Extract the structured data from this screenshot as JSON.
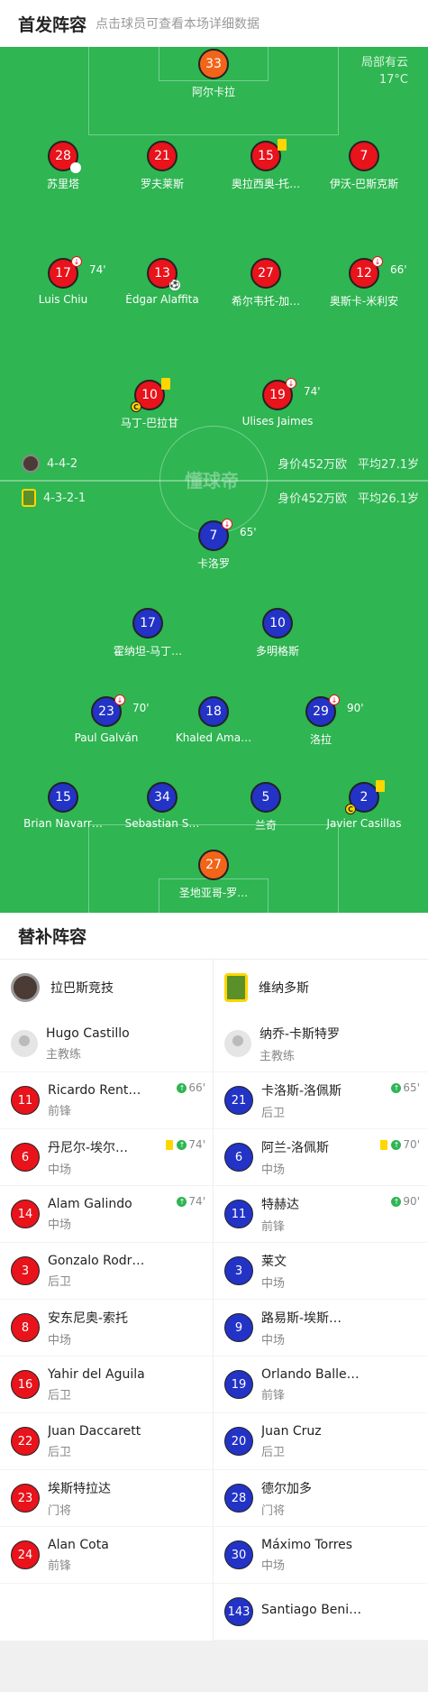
{
  "header": {
    "title": "首发阵容",
    "subtitle": "点击球员可查看本场详细数据"
  },
  "weather": {
    "line1": "局部有云",
    "line2": "17°C"
  },
  "watermark": "懂球帝",
  "home_form": {
    "formation": "4-4-2",
    "value": "身价452万欧",
    "avg_age": "平均27.1岁"
  },
  "away_form": {
    "formation": "4-3-2-1",
    "value": "身价452万欧",
    "avg_age": "平均26.1岁"
  },
  "home_players": {
    "gk": {
      "number": "33",
      "name": "阿尔卡拉"
    },
    "d1": {
      "number": "28",
      "name": "苏里塔"
    },
    "d2": {
      "number": "21",
      "name": "罗夫莱斯"
    },
    "d3": {
      "number": "15",
      "name": "奥拉西奥-托…"
    },
    "d4": {
      "number": "7",
      "name": "伊沃-巴斯克斯"
    },
    "m1": {
      "number": "17",
      "name": "Luis Chiu",
      "minute": "74'"
    },
    "m2": {
      "number": "13",
      "name": "Édgar Alaffita"
    },
    "m3": {
      "number": "27",
      "name": "希尔韦托-加…"
    },
    "m4": {
      "number": "12",
      "name": "奥斯卡-米利安",
      "minute": "66'"
    },
    "f1": {
      "number": "10",
      "name": "马丁-巴拉甘"
    },
    "f2": {
      "number": "19",
      "name": "Ulises Jaimes",
      "minute": "74'"
    }
  },
  "away_players": {
    "f1": {
      "number": "7",
      "name": "卡洛罗",
      "minute": "65'"
    },
    "am1": {
      "number": "17",
      "name": "霍纳坦-马丁…"
    },
    "am2": {
      "number": "10",
      "name": "多明格斯"
    },
    "m1": {
      "number": "23",
      "name": "Paul Galván",
      "minute": "70'"
    },
    "m2": {
      "number": "18",
      "name": "Khaled Ama…"
    },
    "m3": {
      "number": "29",
      "name": "洛拉",
      "minute": "90'"
    },
    "d1": {
      "number": "15",
      "name": "Brian Navarr…"
    },
    "d2": {
      "number": "34",
      "name": "Sebastian S…"
    },
    "d3": {
      "number": "5",
      "name": "兰奇"
    },
    "d4": {
      "number": "2",
      "name": "Javier Casillas"
    },
    "gk": {
      "number": "27",
      "name": "圣地亚哥-罗…"
    }
  },
  "subs": {
    "title": "替补阵容",
    "home": {
      "team_name": "拉巴斯竞技",
      "coach": {
        "name": "Hugo Castillo",
        "role": "主教练"
      },
      "players": [
        {
          "number": "11",
          "name": "Ricardo Rent…",
          "pos": "前锋",
          "minute": "66'"
        },
        {
          "number": "6",
          "name": "丹尼尔-埃尔…",
          "pos": "中场",
          "minute": "74'"
        },
        {
          "number": "14",
          "name": "Alam Galindo",
          "pos": "中场",
          "minute": "74'"
        },
        {
          "number": "3",
          "name": "Gonzalo Rodr…",
          "pos": "后卫"
        },
        {
          "number": "8",
          "name": "安东尼奥-索托",
          "pos": "中场"
        },
        {
          "number": "16",
          "name": "Yahir del Aguila",
          "pos": "后卫"
        },
        {
          "number": "22",
          "name": "Juan Daccarett",
          "pos": "后卫"
        },
        {
          "number": "23",
          "name": "埃斯特拉达",
          "pos": "门将"
        },
        {
          "number": "24",
          "name": "Alan Cota",
          "pos": "前锋"
        }
      ]
    },
    "away": {
      "team_name": "维纳多斯",
      "coach": {
        "name": "纳乔-卡斯特罗",
        "role": "主教练"
      },
      "players": [
        {
          "number": "21",
          "name": "卡洛斯-洛佩斯",
          "pos": "后卫",
          "minute": "65'"
        },
        {
          "number": "6",
          "name": "阿兰-洛佩斯",
          "pos": "中场",
          "minute": "70'"
        },
        {
          "number": "11",
          "name": "特赫达",
          "pos": "前锋",
          "minute": "90'"
        },
        {
          "number": "3",
          "name": "莱文",
          "pos": "中场"
        },
        {
          "number": "9",
          "name": "路易斯-埃斯…",
          "pos": "中场"
        },
        {
          "number": "19",
          "name": "Orlando Balle…",
          "pos": "前锋"
        },
        {
          "number": "20",
          "name": "Juan Cruz",
          "pos": "后卫"
        },
        {
          "number": "28",
          "name": "德尔加多",
          "pos": "门将"
        },
        {
          "number": "30",
          "name": "Máximo Torres",
          "pos": "中场"
        },
        {
          "number": "143",
          "name": "Santiago Beni…",
          "pos": ""
        }
      ]
    }
  }
}
